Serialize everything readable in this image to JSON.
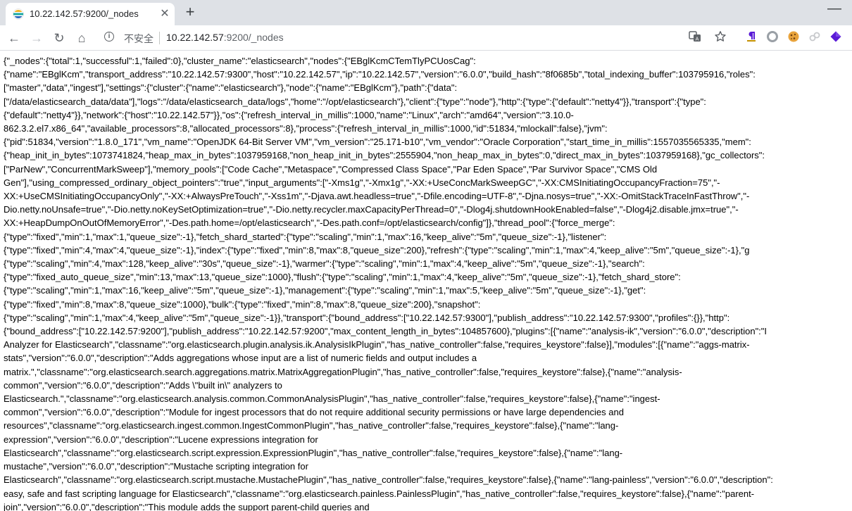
{
  "tab": {
    "title": "10.22.142.57:9200/_nodes",
    "close": "✕",
    "new_tab": "+"
  },
  "window": {
    "minimize": "—"
  },
  "toolbar": {
    "back": "←",
    "forward": "→",
    "reload": "↻",
    "home": "⌂",
    "security_label": "不安全",
    "url_host": "10.22.142.57",
    "url_rest": ":9200/_nodes"
  },
  "icons": [
    "translate-icon",
    "star-icon",
    "paragraph-extension-icon",
    "circle-extension-icon",
    "cookie-extension-icon",
    "link-extension-icon",
    "diamond-extension-icon"
  ],
  "colors": {
    "tabstrip": "#dee1e6",
    "toolbar": "#ffffff",
    "text": "#000000",
    "extension_purple": "#5a1bd6",
    "extension_gold": "#c49000"
  },
  "page": {
    "lines": [
      "{\"_nodes\":{\"total\":1,\"successful\":1,\"failed\":0},\"cluster_name\":\"elasticsearch\",\"nodes\":{\"EBglKcmCTemTlyPCUosCag\":",
      "{\"name\":\"EBglKcm\",\"transport_address\":\"10.22.142.57:9300\",\"host\":\"10.22.142.57\",\"ip\":\"10.22.142.57\",\"version\":\"6.0.0\",\"build_hash\":\"8f0685b\",\"total_indexing_buffer\":103795916,\"roles\":",
      "[\"master\",\"data\",\"ingest\"],\"settings\":{\"cluster\":{\"name\":\"elasticsearch\"},\"node\":{\"name\":\"EBglKcm\"},\"path\":{\"data\":",
      "[\"/data/elasticsearch_data/data\"],\"logs\":\"/data/elasticsearch_data/logs\",\"home\":\"/opt/elasticsearch\"},\"client\":{\"type\":\"node\"},\"http\":{\"type\":{\"default\":\"netty4\"}},\"transport\":{\"type\":",
      "{\"default\":\"netty4\"}},\"network\":{\"host\":\"10.22.142.57\"}},\"os\":{\"refresh_interval_in_millis\":1000,\"name\":\"Linux\",\"arch\":\"amd64\",\"version\":\"3.10.0-",
      "862.3.2.el7.x86_64\",\"available_processors\":8,\"allocated_processors\":8},\"process\":{\"refresh_interval_in_millis\":1000,\"id\":51834,\"mlockall\":false},\"jvm\":",
      "{\"pid\":51834,\"version\":\"1.8.0_171\",\"vm_name\":\"OpenJDK 64-Bit Server VM\",\"vm_version\":\"25.171-b10\",\"vm_vendor\":\"Oracle Corporation\",\"start_time_in_millis\":1557035565335,\"mem\":",
      "{\"heap_init_in_bytes\":1073741824,\"heap_max_in_bytes\":1037959168,\"non_heap_init_in_bytes\":2555904,\"non_heap_max_in_bytes\":0,\"direct_max_in_bytes\":1037959168},\"gc_collectors\":",
      "[\"ParNew\",\"ConcurrentMarkSweep\"],\"memory_pools\":[\"Code Cache\",\"Metaspace\",\"Compressed Class Space\",\"Par Eden Space\",\"Par Survivor Space\",\"CMS Old",
      "Gen\"],\"using_compressed_ordinary_object_pointers\":\"true\",\"input_arguments\":[\"-Xms1g\",\"-Xmx1g\",\"-XX:+UseConcMarkSweepGC\",\"-XX:CMSInitiatingOccupancyFraction=75\",\"-",
      "XX:+UseCMSInitiatingOccupancyOnly\",\"-XX:+AlwaysPreTouch\",\"-Xss1m\",\"-Djava.awt.headless=true\",\"-Dfile.encoding=UTF-8\",\"-Djna.nosys=true\",\"-XX:-OmitStackTraceInFastThrow\",\"-",
      "Dio.netty.noUnsafe=true\",\"-Dio.netty.noKeySetOptimization=true\",\"-Dio.netty.recycler.maxCapacityPerThread=0\",\"-Dlog4j.shutdownHookEnabled=false\",\"-Dlog4j2.disable.jmx=true\",\"-",
      "XX:+HeapDumpOnOutOfMemoryError\",\"-Des.path.home=/opt/elasticsearch\",\"-Des.path.conf=/opt/elasticsearch/config\"]},\"thread_pool\":{\"force_merge\":",
      "{\"type\":\"fixed\",\"min\":1,\"max\":1,\"queue_size\":-1},\"fetch_shard_started\":{\"type\":\"scaling\",\"min\":1,\"max\":16,\"keep_alive\":\"5m\",\"queue_size\":-1},\"listener\":",
      "{\"type\":\"fixed\",\"min\":4,\"max\":4,\"queue_size\":-1},\"index\":{\"type\":\"fixed\",\"min\":8,\"max\":8,\"queue_size\":200},\"refresh\":{\"type\":\"scaling\",\"min\":1,\"max\":4,\"keep_alive\":\"5m\",\"queue_size\":-1},\"g",
      "{\"type\":\"scaling\",\"min\":4,\"max\":128,\"keep_alive\":\"30s\",\"queue_size\":-1},\"warmer\":{\"type\":\"scaling\",\"min\":1,\"max\":4,\"keep_alive\":\"5m\",\"queue_size\":-1},\"search\":",
      "{\"type\":\"fixed_auto_queue_size\",\"min\":13,\"max\":13,\"queue_size\":1000},\"flush\":{\"type\":\"scaling\",\"min\":1,\"max\":4,\"keep_alive\":\"5m\",\"queue_size\":-1},\"fetch_shard_store\":",
      "{\"type\":\"scaling\",\"min\":1,\"max\":16,\"keep_alive\":\"5m\",\"queue_size\":-1},\"management\":{\"type\":\"scaling\",\"min\":1,\"max\":5,\"keep_alive\":\"5m\",\"queue_size\":-1},\"get\":",
      "{\"type\":\"fixed\",\"min\":8,\"max\":8,\"queue_size\":1000},\"bulk\":{\"type\":\"fixed\",\"min\":8,\"max\":8,\"queue_size\":200},\"snapshot\":",
      "{\"type\":\"scaling\",\"min\":1,\"max\":4,\"keep_alive\":\"5m\",\"queue_size\":-1}},\"transport\":{\"bound_address\":[\"10.22.142.57:9300\"],\"publish_address\":\"10.22.142.57:9300\",\"profiles\":{}},\"http\":",
      "{\"bound_address\":[\"10.22.142.57:9200\"],\"publish_address\":\"10.22.142.57:9200\",\"max_content_length_in_bytes\":104857600},\"plugins\":[{\"name\":\"analysis-ik\",\"version\":\"6.0.0\",\"description\":\"I",
      "Analyzer for Elasticsearch\",\"classname\":\"org.elasticsearch.plugin.analysis.ik.AnalysisIkPlugin\",\"has_native_controller\":false,\"requires_keystore\":false}],\"modules\":[{\"name\":\"aggs-matrix-",
      "stats\",\"version\":\"6.0.0\",\"description\":\"Adds aggregations whose input are a list of numeric fields and output includes a",
      "matrix.\",\"classname\":\"org.elasticsearch.search.aggregations.matrix.MatrixAggregationPlugin\",\"has_native_controller\":false,\"requires_keystore\":false},{\"name\":\"analysis-",
      "common\",\"version\":\"6.0.0\",\"description\":\"Adds \\\"built in\\\" analyzers to",
      "Elasticsearch.\",\"classname\":\"org.elasticsearch.analysis.common.CommonAnalysisPlugin\",\"has_native_controller\":false,\"requires_keystore\":false},{\"name\":\"ingest-",
      "common\",\"version\":\"6.0.0\",\"description\":\"Module for ingest processors that do not require additional security permissions or have large dependencies and",
      "resources\",\"classname\":\"org.elasticsearch.ingest.common.IngestCommonPlugin\",\"has_native_controller\":false,\"requires_keystore\":false},{\"name\":\"lang-",
      "expression\",\"version\":\"6.0.0\",\"description\":\"Lucene expressions integration for",
      "Elasticsearch\",\"classname\":\"org.elasticsearch.script.expression.ExpressionPlugin\",\"has_native_controller\":false,\"requires_keystore\":false},{\"name\":\"lang-",
      "mustache\",\"version\":\"6.0.0\",\"description\":\"Mustache scripting integration for",
      "Elasticsearch\",\"classname\":\"org.elasticsearch.script.mustache.MustachePlugin\",\"has_native_controller\":false,\"requires_keystore\":false},{\"name\":\"lang-painless\",\"version\":\"6.0.0\",\"description\":",
      "easy, safe and fast scripting language for Elasticsearch\",\"classname\":\"org.elasticsearch.painless.PainlessPlugin\",\"has_native_controller\":false,\"requires_keystore\":false},{\"name\":\"parent-",
      "join\",\"version\":\"6.0.0\",\"description\":\"This module adds the support parent-child queries and"
    ]
  }
}
